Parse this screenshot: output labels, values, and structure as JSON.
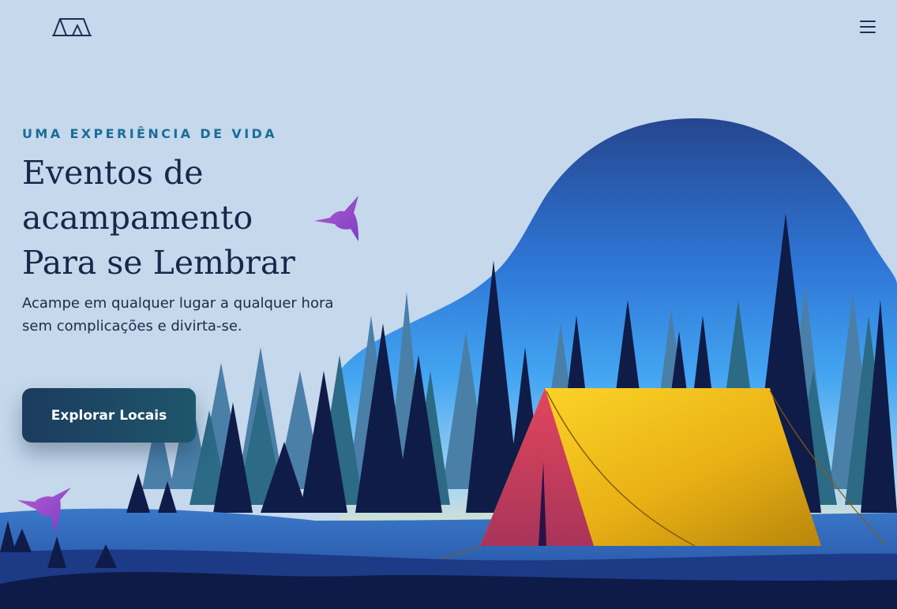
{
  "header": {
    "logo_icon": "tent-logo-icon",
    "menu_icon": "hamburger-menu-icon"
  },
  "hero": {
    "eyebrow": "UMA EXPERIÊNCIA DE VIDA",
    "title_line1": "Eventos de",
    "title_line2": "acampamento",
    "title_line3": "Para se Lembrar",
    "subtitle": "Acampe em qualquer lugar a qualquer hora sem complicações e divirta-se.",
    "cta_label": "Explorar Locais"
  },
  "illustration": {
    "icons": [
      "hummingbird-icon",
      "tent-icon",
      "pine-tree-icon"
    ],
    "colors": {
      "background": "#c5d8ec",
      "sky_top": "#2a4f9e",
      "sky_mid": "#3fa0f0",
      "tent_yellow": "#f5c518",
      "tent_red": "#d63a58",
      "forest_dark": "#0e1b44",
      "bird_purple": "#9a4fc9"
    }
  }
}
